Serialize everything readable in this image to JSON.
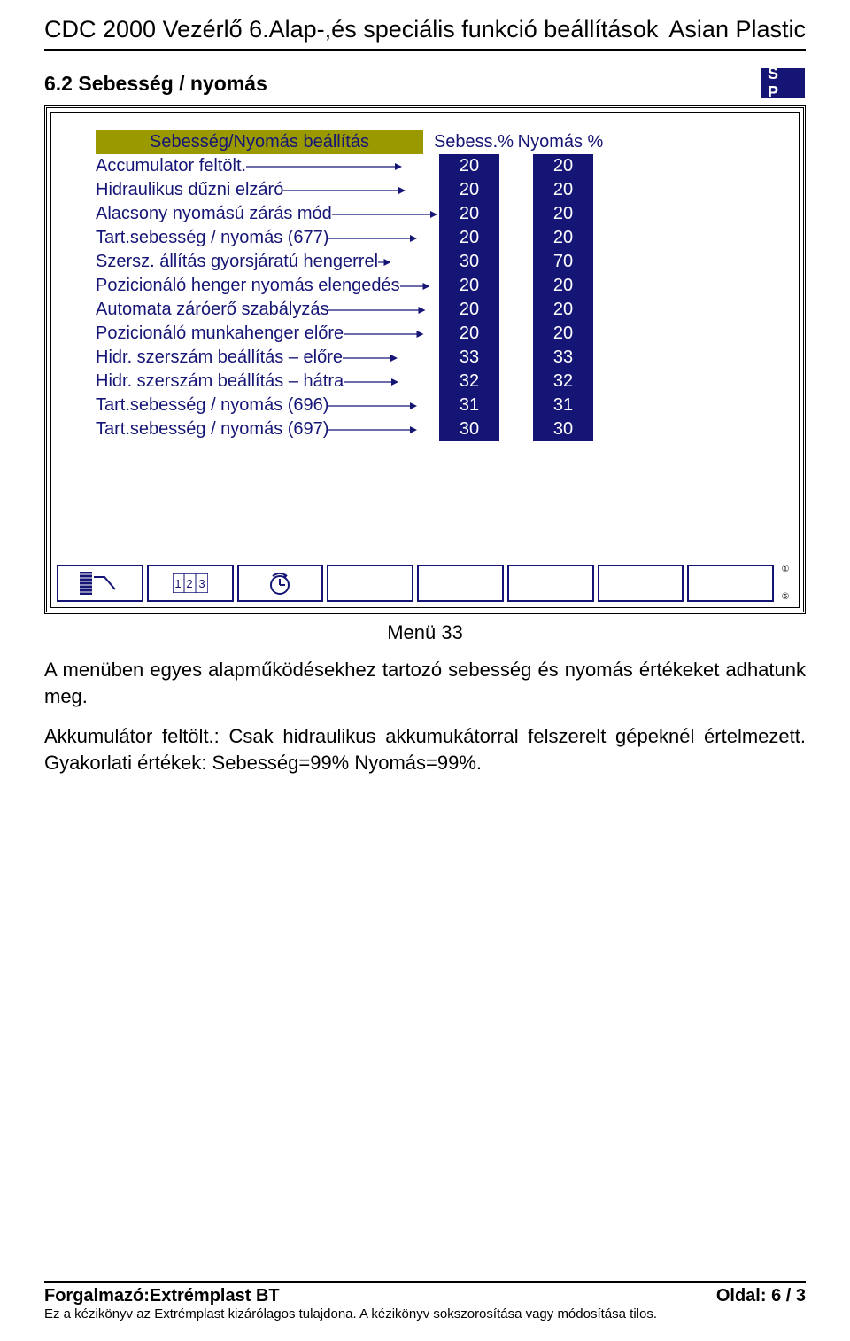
{
  "header": {
    "left": "CDC 2000 Vezérlő  6.Alap-,és speciális funkció beállítások",
    "right": "Asian Plastic"
  },
  "section": {
    "title": "6.2 Sebesség / nyomás",
    "sp_label": "S P"
  },
  "chart_data": {
    "type": "table",
    "title": "Sebesség/Nyomás beállítás",
    "columns": [
      "Sebess.%",
      "Nyomás %"
    ],
    "rows": [
      {
        "label": "Accumulator feltölt.",
        "speed": 20,
        "pressure": 20
      },
      {
        "label": "Hidraulikus dűzni elzáró",
        "speed": 20,
        "pressure": 20
      },
      {
        "label": "Alacsony nyomású zárás mód",
        "speed": 20,
        "pressure": 20
      },
      {
        "label": "Tart.sebesség / nyomás (677)",
        "speed": 20,
        "pressure": 20
      },
      {
        "label": "Szersz. állítás gyorsjáratú hengerrel",
        "speed": 30,
        "pressure": 70
      },
      {
        "label": "Pozicionáló henger nyomás elengedés",
        "speed": 20,
        "pressure": 20
      },
      {
        "label": "Automata záróerő szabályzás",
        "speed": 20,
        "pressure": 20
      },
      {
        "label": "Pozicionáló munkahenger előre",
        "speed": 20,
        "pressure": 20
      },
      {
        "label": "Hidr. szerszám beállítás – előre",
        "speed": 33,
        "pressure": 33
      },
      {
        "label": "Hidr. szerszám beállítás – hátra",
        "speed": 32,
        "pressure": 32
      },
      {
        "label": "Tart.sebesség / nyomás (696)",
        "speed": 31,
        "pressure": 31
      },
      {
        "label": "Tart.sebesség / nyomás (697)",
        "speed": 30,
        "pressure": 30
      }
    ]
  },
  "toolbar": {
    "icons": [
      "chart-icon",
      "numbers-icon",
      "clock-icon"
    ],
    "side_top": "①",
    "side_bottom": "⑥"
  },
  "caption": "Menü 33",
  "paragraphs": [
    "A menüben egyes alapműködésekhez tartozó sebesség és nyomás értékeket adhatunk meg.",
    "Akkumulátor feltölt.: Csak hidraulikus akkumukátorral felszerelt gépeknél értelmezett. Gyakorlati értékek: Sebesség=99% Nyomás=99%."
  ],
  "footer": {
    "left": "Forgalmazó:Extrémplast BT",
    "right": "Oldal: 6 / 3",
    "note": "Ez a kézikönyv az Extrémplast kizárólagos tulajdona. A kézikönyv sokszorosítása vagy módosítása tilos."
  }
}
